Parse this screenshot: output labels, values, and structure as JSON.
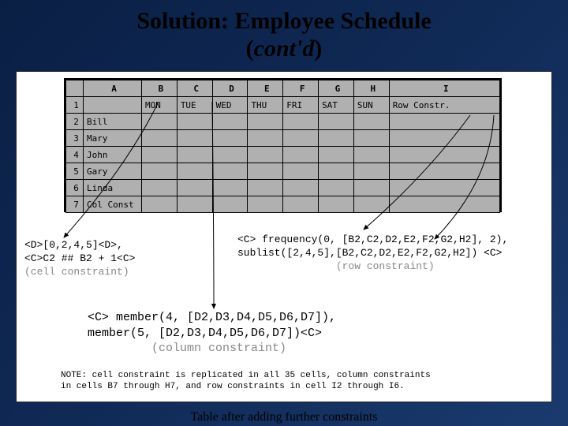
{
  "title_line1": "Solution: Employee Schedule",
  "title_line2": "(cont'd)",
  "table": {
    "colHeaders": [
      "A",
      "B",
      "C",
      "D",
      "E",
      "F",
      "G",
      "H",
      "I"
    ],
    "rowHeaders": [
      "1",
      "2",
      "3",
      "4",
      "5",
      "6",
      "7"
    ],
    "row1": [
      "",
      "MON",
      "TUE",
      "WED",
      "THU",
      "FRI",
      "SAT",
      "SUN",
      "Row Constr."
    ],
    "labels": [
      "Bill",
      "Mary",
      "John",
      "Gary",
      "Linda",
      "Col Const"
    ]
  },
  "cellConstraint": {
    "l1": "<D>[0,2,4,5]<D>,",
    "l2": "<C>C2 ## B2 + 1<C>",
    "sub": "(cell constraint)"
  },
  "rowConstraint": {
    "l1": "<C> frequency(0, [B2,C2,D2,E2,F2,G2,H2], 2),",
    "l2": "sublist([2,4,5],[B2,C2,D2,E2,F2,G2,H2]) <C>",
    "sub": "(row constraint)"
  },
  "colConstraint": {
    "l1": "<C> member(4, [D2,D3,D4,D5,D6,D7]),",
    "l2": "member(5, [D2,D3,D4,D5,D6,D7])<C>",
    "sub": "(column constraint)"
  },
  "note": "NOTE: cell constraint is replicated in all 35 cells, column constraints\nin cells B7 through H7, and row constraints in cell I2 through I6.",
  "caption": "Table after adding further constraints"
}
